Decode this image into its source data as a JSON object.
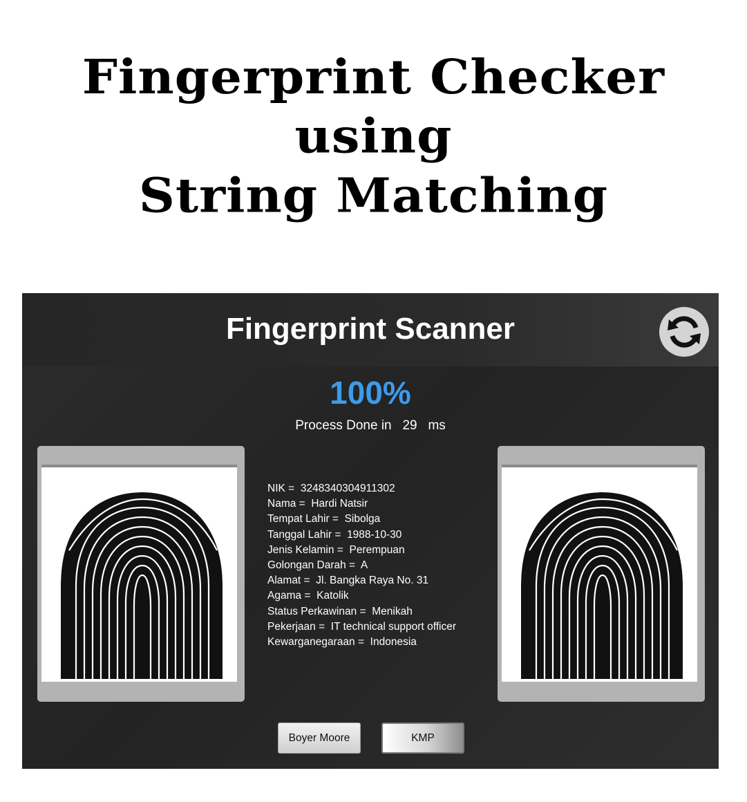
{
  "banner": {
    "line1": "Fingerprint Checker",
    "line2": "using",
    "line3": "String Matching"
  },
  "app": {
    "title": "Fingerprint Scanner",
    "refresh_icon": "refresh-icon",
    "progress_text": "100%",
    "progress_value": 1.0,
    "process_prefix": "Process Done in",
    "process_time": "29",
    "process_unit": "ms",
    "accent_color": "#3d9bea"
  },
  "info": [
    {
      "label": "NIK",
      "value": "3248340304911302"
    },
    {
      "label": "Nama",
      "value": "Hardi Natsir"
    },
    {
      "label": "Tempat Lahir",
      "value": "Sibolga"
    },
    {
      "label": "Tanggal Lahir",
      "value": "1988-10-30"
    },
    {
      "label": "Jenis Kelamin",
      "value": "Perempuan"
    },
    {
      "label": "Golongan Darah",
      "value": "A"
    },
    {
      "label": "Alamat",
      "value": "Jl. Bangka Raya No. 31"
    },
    {
      "label": "Agama",
      "value": "Katolik"
    },
    {
      "label": "Status Perkawinan",
      "value": "Menikah"
    },
    {
      "label": "Pekerjaan",
      "value": "IT technical support officer"
    },
    {
      "label": "Kewarganegaraan",
      "value": "Indonesia"
    }
  ],
  "buttons": {
    "boyer_moore": "Boyer Moore",
    "kmp": "KMP"
  }
}
